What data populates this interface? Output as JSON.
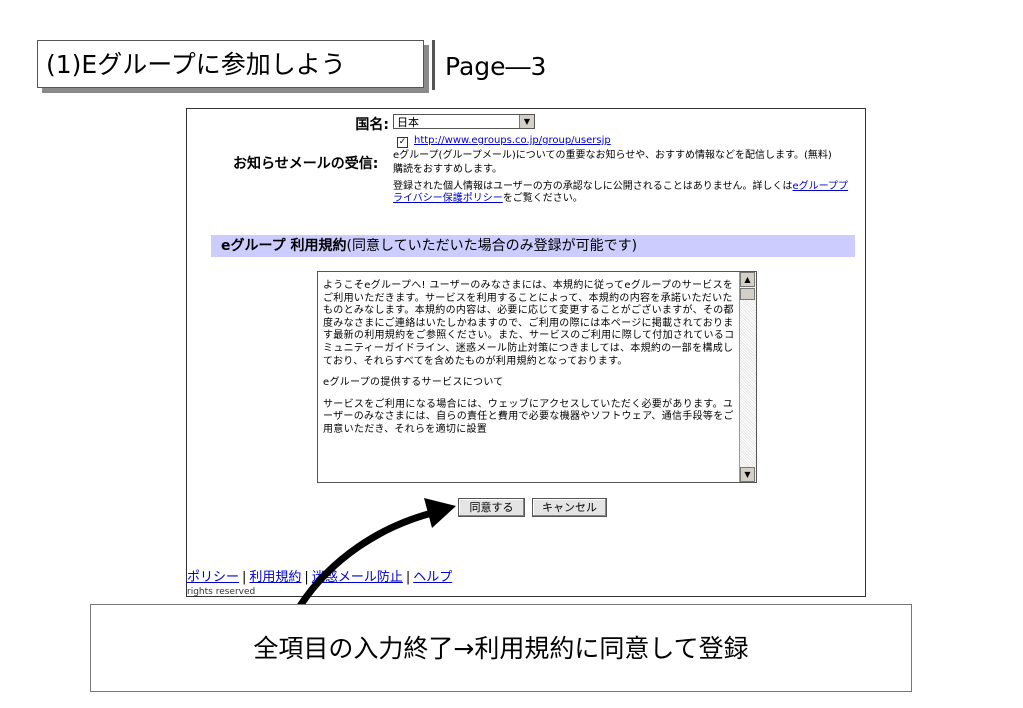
{
  "slide": {
    "title": "(1)Eグループに参加しよう",
    "page_label": "Page―3",
    "caption": "全項目の入力終了→利用規約に同意して登録"
  },
  "form": {
    "country_label": "国名:",
    "country_value": "日本",
    "mail_label": "お知らせメールの受信:",
    "mail_checked": true,
    "mail_url": "http://www.egroups.co.jp/group/usersjp",
    "mail_description": "eグループ(グループメール)についての重要なお知らせや、おすすめ情報などを配信します。(無料)",
    "mail_recommend": "購読をおすすめします。",
    "privacy_text_before": "登録された個人情報はユーザーの方の承認なしに公開されることはありません。詳しくは",
    "privacy_link": "eグループプライバシー保護ポリシー",
    "privacy_text_after": "をご覧ください。"
  },
  "terms": {
    "header_bold": "eグループ 利用規約",
    "header_rest": "(同意していただいた場合のみ登録が可能です)",
    "paragraphs": [
      "ようこそeグループへ! ユーザーのみなさまには、本規約に従ってeグループのサービスをご利用いただきます。サービスを利用することによって、本規約の内容を承諾いただいたものとみなします。本規約の内容は、必要に応じて変更することがございますが、その都度みなさまにご連絡はいたしかねますので、ご利用の際には本ページに掲載されております最新の利用規約をご参照ください。また、サービスのご利用に際して付加されているコミュニティーガイドライン、迷惑メール防止対策につきましては、本規約の一部を構成しており、それらすべてを含めたものが利用規約となっております。",
      "eグループの提供するサービスについて",
      "サービスをご利用になる場合には、ウェッブにアクセスしていただく必要があります。ユーザーのみなさまには、自らの責任と費用で必要な機器やソフトウェア、通信手段等をご用意いただき、それらを適切に設置"
    ]
  },
  "buttons": {
    "agree": "同意する",
    "cancel": "キャンセル"
  },
  "footer": {
    "links": [
      "ポリシー",
      "利用規約",
      "迷惑メール防止",
      "ヘルプ"
    ],
    "rights": "rights reserved"
  }
}
